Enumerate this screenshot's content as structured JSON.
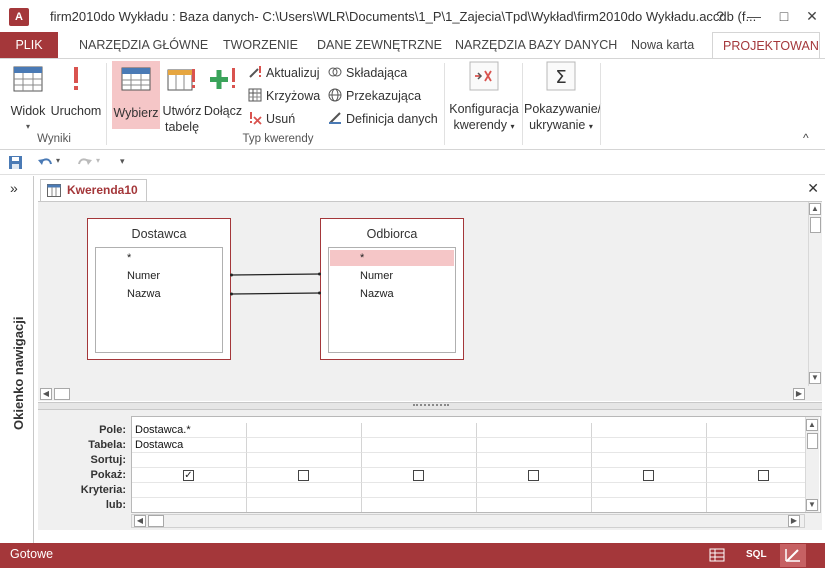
{
  "window": {
    "app_icon": "A",
    "title": "firm2010do Wykładu : Baza danych- C:\\Users\\WLR\\Documents\\1_P\\1_Zajecia\\Tpd\\Wykład\\firm2010do Wykładu.accdb (f...",
    "help": "?",
    "minimize": "—",
    "restore": "□",
    "close": "✕"
  },
  "tabs": [
    "PLIK",
    "NARZĘDZIA GŁÓWNE",
    "TWORZENIE",
    "DANE ZEWNĘTRZNE",
    "NARZĘDZIA BAZY DANYCH",
    "Nowa karta",
    "PROJEKTOWANI"
  ],
  "ribbon": {
    "wyniki": {
      "label": "Wyniki",
      "widok": "Widok",
      "uruchom": "Uruchom"
    },
    "typ": {
      "label": "Typ kwerendy",
      "wybierz": "Wybierz",
      "utworz_1": "Utwórz",
      "utworz_2": "tabelę",
      "dolacz": "Dołącz",
      "aktualizuj": "Aktualizuj",
      "krzyzowa": "Krzyżowa",
      "usun": "Usuń",
      "skladajaca": "Składająca",
      "przekazujaca": "Przekazująca",
      "definicja": "Definicja danych"
    },
    "konfiguracja_1": "Konfiguracja",
    "konfiguracja_2": "kwerendy",
    "pokazywanie_1": "Pokazywanie/",
    "pokazywanie_2": "ukrywanie",
    "collapse": "^",
    "icons": [
      "datasheet-view-icon",
      "run-icon",
      "select-query-icon",
      "make-table-icon",
      "append-icon",
      "update-icon",
      "crosstab-icon",
      "delete-icon",
      "union-icon",
      "pass-through-icon",
      "data-definition-icon",
      "query-setup-icon",
      "totals-icon"
    ]
  },
  "qat": {
    "save": "save-icon",
    "undo": "undo-icon",
    "redo": "redo-icon",
    "customize": "▾"
  },
  "nav_pane": {
    "toggle": "»",
    "label": "Okienko nawigacji"
  },
  "document": {
    "tab_title": "Kwerenda10",
    "close": "✕",
    "tables": [
      {
        "name": "Dostawca",
        "fields": [
          "*",
          "Numer",
          "Nazwa"
        ]
      },
      {
        "name": "Odbiorca",
        "fields": [
          "*",
          "Numer",
          "Nazwa"
        ]
      }
    ],
    "grid": {
      "row_labels": [
        "Pole:",
        "Tabela:",
        "Sortuj:",
        "Pokaż:",
        "Kryteria:",
        "lub:"
      ],
      "columns": [
        {
          "pole": "Dostawca.*",
          "tabela": "Dostawca",
          "show": true
        },
        {
          "pole": "",
          "tabela": "",
          "show": false
        },
        {
          "pole": "",
          "tabela": "",
          "show": false
        },
        {
          "pole": "",
          "tabela": "",
          "show": false
        },
        {
          "pole": "",
          "tabela": "",
          "show": false
        },
        {
          "pole": "",
          "tabela": "",
          "show": false
        }
      ]
    }
  },
  "status": {
    "text": "Gotowe",
    "sql_label": "SQL"
  },
  "colors": {
    "accent": "#a4373a",
    "selection": "#f5c6c7",
    "canvas": "#f0f0f0"
  }
}
